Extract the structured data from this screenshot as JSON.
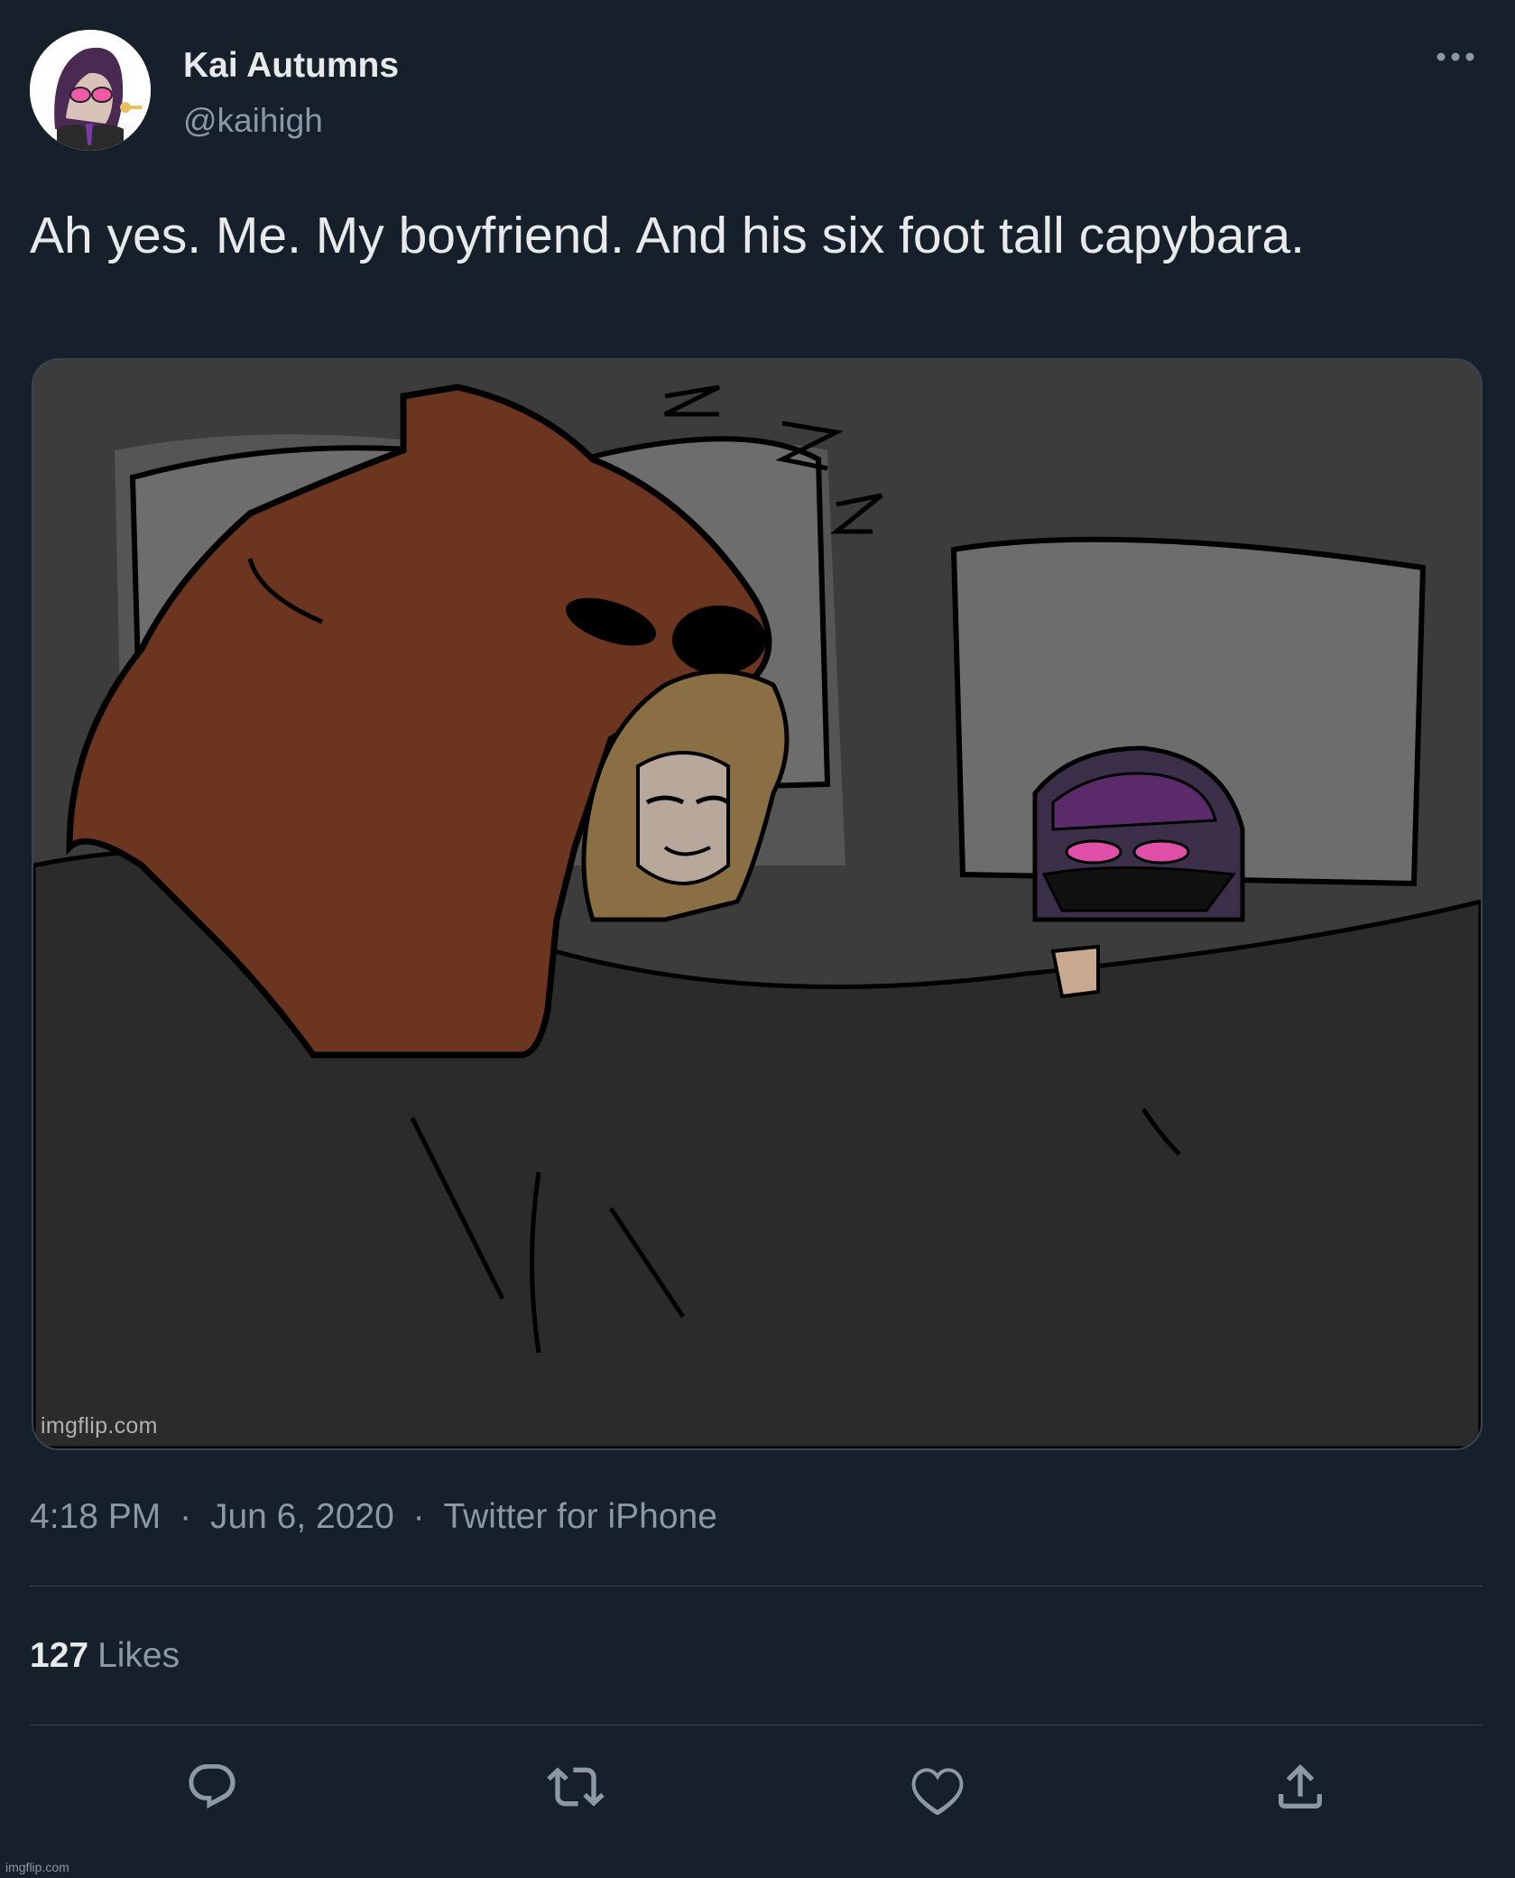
{
  "tweet": {
    "author": {
      "display_name": "Kai Autumns",
      "handle": "@kaihigh",
      "avatar_icon": "avatar-icon"
    },
    "more_icon": "more-icon",
    "text": "Ah yes. Me. My boyfriend. And his six foot tall capybara.",
    "media": {
      "watermark": "imgflip.com"
    },
    "meta": {
      "time": "4:18 PM",
      "separator": "·",
      "date": "Jun 6, 2020",
      "source": "Twitter for iPhone"
    },
    "stats": {
      "likes_count": "127",
      "likes_label": "Likes"
    },
    "actions": {
      "reply_icon": "reply-icon",
      "retweet_icon": "retweet-icon",
      "like_icon": "heart-icon",
      "share_icon": "share-icon"
    },
    "footer_watermark": "imgflip.com"
  },
  "colors": {
    "background": "#15202b",
    "primary_text": "#e7e9ea",
    "secondary_text": "#8b98a5",
    "divider": "#38444d"
  }
}
